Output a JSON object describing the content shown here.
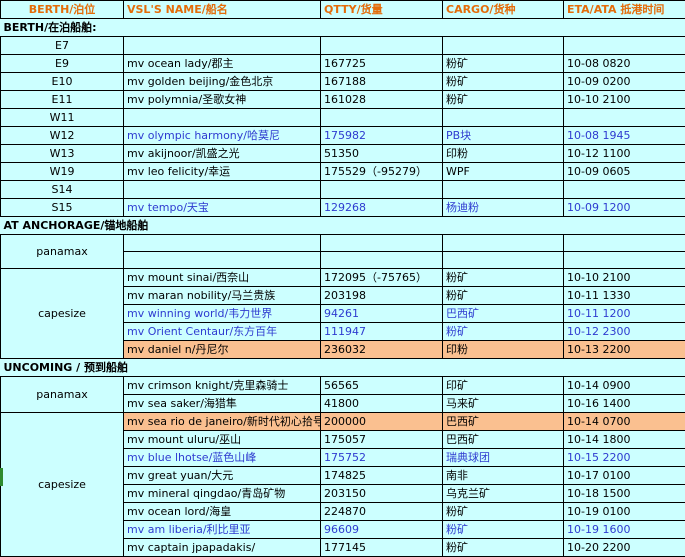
{
  "header": [
    "BERTH/泊位",
    "VSL'S NAME/船名",
    "QTTY/货量",
    "CARGO/货种",
    "ETA/ATA 抵港时间"
  ],
  "sections": [
    {
      "title": "BERTH/在泊船舶:",
      "rows": [
        {
          "c0": "E7",
          "vessel": "",
          "qtty": "",
          "cargo": "",
          "eta": "",
          "style": ""
        },
        {
          "c0": "E9",
          "vessel": "mv ocean lady/郡主",
          "qtty": "167725",
          "cargo": "粉矿",
          "eta": "10-08 0820",
          "style": ""
        },
        {
          "c0": "E10",
          "vessel": "mv golden beijing/金色北京",
          "qtty": "167188",
          "cargo": "粉矿",
          "eta": "10-09 0200",
          "style": ""
        },
        {
          "c0": "E11",
          "vessel": "mv polymnia/圣歌女神",
          "qtty": "161028",
          "cargo": "粉矿",
          "eta": "10-10 2100",
          "style": ""
        },
        {
          "c0": "W11",
          "vessel": "",
          "qtty": "",
          "cargo": "",
          "eta": "",
          "style": ""
        },
        {
          "c0": "W12",
          "vessel": "mv olympic harmony/哈莫尼",
          "qtty": "175982",
          "cargo": "PB块",
          "eta": "10-08 1945",
          "style": "blue"
        },
        {
          "c0": "W13",
          "vessel": "mv akijnoor/凯盛之光",
          "qtty": "51350",
          "cargo": "印粉",
          "eta": "10-12 1100",
          "style": ""
        },
        {
          "c0": "W19",
          "vessel": "mv leo felicity/幸运",
          "qtty": "175529（-95279）",
          "cargo": "WPF",
          "eta": "10-09 0605",
          "style": ""
        },
        {
          "c0": "S14",
          "vessel": "",
          "qtty": "",
          "cargo": "",
          "eta": "",
          "style": ""
        },
        {
          "c0": "S15",
          "vessel": "mv tempo/天宝",
          "qtty": "129268",
          "cargo": "杨迪粉",
          "eta": "10-09 1200",
          "style": "blue"
        }
      ]
    },
    {
      "title": "AT ANCHORAGE/锚地船舶",
      "rows": [
        {
          "c0": "panamax",
          "span": 2,
          "vessel": "",
          "qtty": "",
          "cargo": "",
          "eta": "",
          "style": ""
        },
        {
          "vessel": "",
          "qtty": "",
          "cargo": "",
          "eta": "",
          "style": ""
        },
        {
          "c0": "capesize",
          "span": 5,
          "vessel": "mv mount sinai/西奈山",
          "qtty": "172095（-75765）",
          "cargo": "粉矿",
          "eta": "10-10 2100",
          "style": ""
        },
        {
          "vessel": "mv maran nobility/马兰贵族",
          "qtty": "203198",
          "cargo": "粉矿",
          "eta": "10-11 1330",
          "style": ""
        },
        {
          "vessel": "mv winning world/韦力世界",
          "qtty": "94261",
          "cargo": "巴西矿",
          "eta": "10-11 1200",
          "style": "blue"
        },
        {
          "vessel": "mv Orient Centaur/东方百年",
          "qtty": "111947",
          "cargo": "粉矿",
          "eta": "10-12 2300",
          "style": "blue"
        },
        {
          "vessel": "mv daniel n/丹尼尔",
          "qtty": "236032",
          "cargo": "印粉",
          "eta": "10-13 2200",
          "style": "hl"
        }
      ]
    },
    {
      "title": "UNCOMING / 预到船舶",
      "rows": [
        {
          "c0": "panamax",
          "span": 2,
          "vessel": "mv crimson knight/克里森骑士",
          "qtty": "56565",
          "cargo": "印矿",
          "eta": "10-14 0900",
          "style": ""
        },
        {
          "vessel": "mv sea saker/海猎隼",
          "qtty": "41800",
          "cargo": "马来矿",
          "eta": "10-16 1400",
          "style": ""
        },
        {
          "c0": "capesize",
          "span": 8,
          "vessel": "mv sea rio de janeiro/新时代初心拾号",
          "qtty": "200000",
          "cargo": "巴西矿",
          "eta": "10-14 0700",
          "style": "hl"
        },
        {
          "vessel": "mv mount uluru/巫山",
          "qtty": "175057",
          "cargo": "巴西矿",
          "eta": "10-14 1800",
          "style": ""
        },
        {
          "vessel": "mv blue lhotse/蓝色山峰",
          "qtty": "175752",
          "cargo": "瑞典球团",
          "eta": "10-15 2200",
          "style": "blue"
        },
        {
          "vessel": "mv great yuan/大元",
          "qtty": "174825",
          "cargo": "南非",
          "eta": "10-17 0100",
          "style": ""
        },
        {
          "vessel": "mv mineral qingdao/青岛矿物",
          "qtty": "203150",
          "cargo": "乌克兰矿",
          "eta": "10-18 1500",
          "style": ""
        },
        {
          "vessel": "mv ocean lord/海皇",
          "qtty": "224870",
          "cargo": "粉矿",
          "eta": "10-19 0100",
          "style": ""
        },
        {
          "vessel": "mv am liberia/利比里亚",
          "qtty": "96609",
          "cargo": "粉矿",
          "eta": "10-19 1600",
          "style": "blue"
        },
        {
          "vessel": "mv captain jpapadakis/",
          "qtty": "177145",
          "cargo": "粉矿",
          "eta": "10-20 2200",
          "style": ""
        }
      ]
    }
  ]
}
